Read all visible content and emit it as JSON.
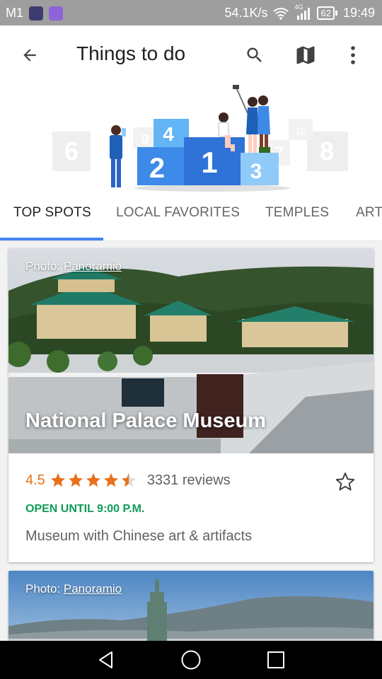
{
  "status_bar": {
    "carrier": "M1",
    "net_speed": "54.1K/s",
    "network_type": "4G",
    "battery": "62",
    "time": "19:49"
  },
  "app_bar": {
    "title": "Things to do",
    "icons": [
      "back-arrow-icon",
      "search-icon",
      "map-icon",
      "more-vert-icon"
    ]
  },
  "hero": {
    "podium": [
      "2",
      "1",
      "3"
    ],
    "top_block": "4",
    "background_blocks": [
      "6",
      "8",
      "10",
      "7",
      "9"
    ]
  },
  "tabs": [
    {
      "label": "TOP SPOTS",
      "active": true
    },
    {
      "label": "LOCAL FAVORITES",
      "active": false
    },
    {
      "label": "TEMPLES",
      "active": false
    },
    {
      "label": "ART",
      "active": false
    }
  ],
  "cards": [
    {
      "photo_prefix": "Photo: ",
      "photo_source": "Panoramio",
      "name": "National Palace Museum",
      "rating": "4.5",
      "stars": 4.5,
      "reviews": "3331 reviews",
      "hours": "OPEN UNTIL 9:00 P.M.",
      "description": "Museum with Chinese art & artifacts"
    },
    {
      "photo_prefix": "Photo: ",
      "photo_source": "Panoramio"
    }
  ],
  "colors": {
    "status_bar": "#9e9e9e",
    "tab_indicator": "#4285f4",
    "rating": "#e7711b",
    "open": "#0f9d58"
  },
  "nav_bar": {
    "icons": [
      "back-triangle-icon",
      "home-circle-icon",
      "recents-square-icon"
    ]
  }
}
